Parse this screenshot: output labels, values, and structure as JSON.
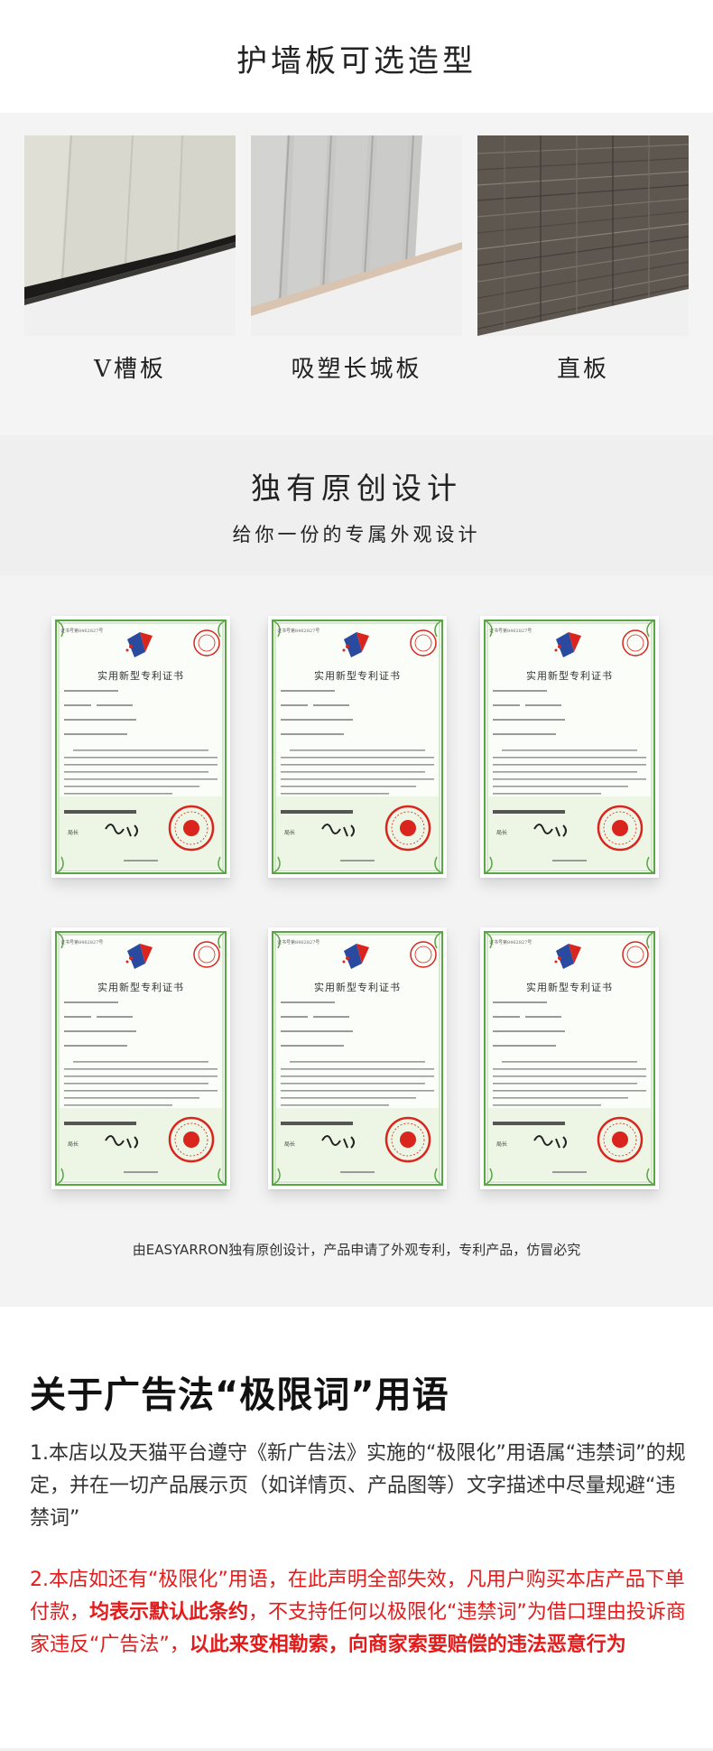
{
  "styles_section": {
    "title": "护墙板可选造型",
    "samples": [
      {
        "label": "V槽板"
      },
      {
        "label": "吸塑长城板"
      },
      {
        "label": "直板"
      }
    ]
  },
  "original_section": {
    "title": "独有原创设计",
    "subtitle": "给你一份的专属外观设计"
  },
  "certificates": {
    "cert_title": "实用新型专利证书",
    "items": [
      {
        "no": "证书号第8462827号"
      },
      {
        "no": "证书号第8462827号"
      },
      {
        "no": "证书号第8462827号"
      },
      {
        "no": "证书号第8462827号"
      },
      {
        "no": "证书号第8462827号"
      },
      {
        "no": "证书号第8462827号"
      }
    ],
    "note": "由EASYARRON独有原创设计，产品申请了外观专利，专利产品，仿冒必究"
  },
  "notice": {
    "title": "关于广告法“极限词”用语",
    "p1": "1.本店以及天猫平台遵守《新广告法》实施的“极限化”用语属“违禁词”的规定，并在一切产品展示页（如详情页、产品图等）文字描述中尽量规避“违禁词”",
    "p2_part1": "2.本店如还有“极限化”用语，在此声明全部失效，凡用户购买本店产品下单付款，",
    "p2_bold1": "均表示默认此条约",
    "p2_part2": "，不支持任何以极限化“违禁词”为借口理由投诉商家违反“广告法”，",
    "p2_bold2": "以此来变相勒索，向商家索要赔偿的违法恶意行为"
  },
  "colors": {
    "text_dark": "#222222",
    "notice_red": "#e31b1b",
    "cert_green": "#5aa545",
    "seal_red": "#d9251d"
  }
}
